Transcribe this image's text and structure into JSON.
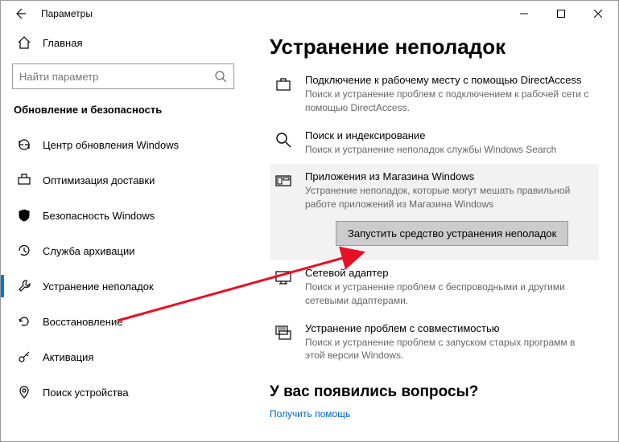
{
  "window": {
    "title": "Параметры"
  },
  "sidebar": {
    "home": "Главная",
    "search_placeholder": "Найти параметр",
    "section": "Обновление и безопасность",
    "items": [
      {
        "label": "Центр обновления Windows"
      },
      {
        "label": "Оптимизация доставки"
      },
      {
        "label": "Безопасность Windows"
      },
      {
        "label": "Служба архивации"
      },
      {
        "label": "Устранение неполадок"
      },
      {
        "label": "Восстановление"
      },
      {
        "label": "Активация"
      },
      {
        "label": "Поиск устройства"
      }
    ]
  },
  "main": {
    "heading": "Устранение неполадок",
    "items": [
      {
        "title": "Подключение к рабочему месту с помощью DirectAccess",
        "desc": "Поиск и устранение проблем с подключением к рабочей сети с помощью DirectAccess."
      },
      {
        "title": "Поиск и индексирование",
        "desc": "Поиск и устранение неполадок службы Windows Search"
      },
      {
        "title": "Приложения из Магазина Windows",
        "desc": "Устранение неполадок, которые могут мешать правильной работе приложений из Магазина Windows",
        "button": "Запустить средство устранения неполадок"
      },
      {
        "title": "Сетевой адаптер",
        "desc": "Поиск и устранение проблем с беспроводными и другими сетевыми адаптерами."
      },
      {
        "title": "Устранение проблем с совместимостью",
        "desc": "Поиск и устранение проблем с запуском старых программ в этой версии Windows."
      }
    ],
    "questions_heading": "У вас появились вопросы?",
    "help_link": "Получить помощь"
  }
}
